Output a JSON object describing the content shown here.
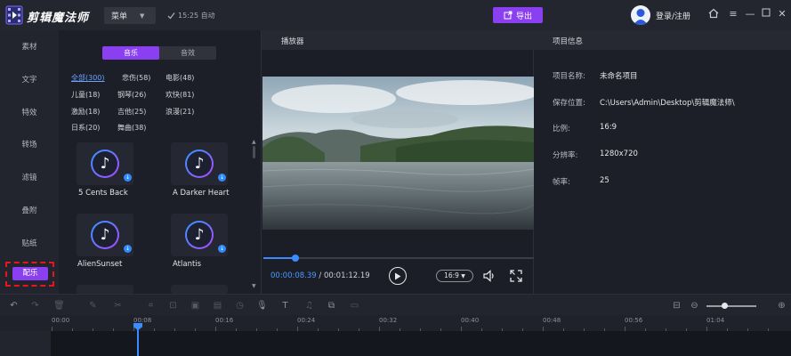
{
  "app": {
    "title": "剪辑魔法师",
    "menu_label": "菜单",
    "autosave": "15:25 自动",
    "export_label": "导出",
    "login_label": "登录/注册"
  },
  "left_nav": {
    "items": [
      "素材",
      "文字",
      "特效",
      "转场",
      "滤镜",
      "叠附",
      "贴纸"
    ],
    "active": "配乐"
  },
  "music": {
    "tabs": [
      "音乐",
      "音效"
    ],
    "categories": [
      [
        "全部(300)",
        "悲伤(58)",
        "电影(48)"
      ],
      [
        "儿童(18)",
        "钢琴(26)",
        "欢快(81)"
      ],
      [
        "激励(18)",
        "吉他(25)",
        "浪漫(21)"
      ],
      [
        "日系(20)",
        "舞曲(38)"
      ]
    ],
    "tracks": [
      "5 Cents Back",
      "A Darker Heart",
      "AlienSunset",
      "Atlantis"
    ]
  },
  "player": {
    "title": "播放器",
    "current_time": "00:00:08.39",
    "separator": " / ",
    "total_time": "00:01:12.19",
    "progress": 0.12,
    "ratio": "16:9"
  },
  "project_info": {
    "title": "项目信息",
    "name_label": "项目名称:",
    "name_value": "未命名项目",
    "path_label": "保存位置:",
    "path_value": "C:\\Users\\Admin\\Desktop\\剪辑魔法师\\",
    "ratio_label": "比例:",
    "ratio_value": "16:9",
    "resolution_label": "分辨率:",
    "resolution_value": "1280x720",
    "fps_label": "帧率:",
    "fps_value": "25"
  },
  "timeline": {
    "ticks": [
      "00:00",
      "00:08",
      "00:16",
      "00:24",
      "00:32",
      "00:40",
      "00:48",
      "00:56",
      "01:04"
    ]
  },
  "colors": {
    "accent": "#8a3ff0",
    "highlight": "#3a8cff",
    "annotation": "#e8161a"
  }
}
